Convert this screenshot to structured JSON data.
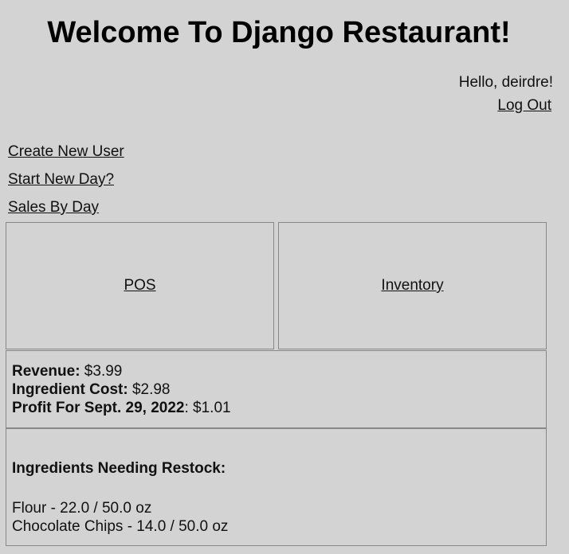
{
  "header": {
    "title": "Welcome To Django Restaurant!",
    "greeting": "Hello, deirdre!",
    "logout_label": "Log Out"
  },
  "nav": {
    "links": [
      {
        "label": "Create New User"
      },
      {
        "label": "Start New Day?"
      },
      {
        "label": "Sales By Day"
      }
    ]
  },
  "tiles": {
    "pos_label": "POS",
    "inventory_label": "Inventory"
  },
  "stats": {
    "revenue_label": "Revenue:",
    "revenue_value": " $3.99",
    "cost_label": "Ingredient Cost:",
    "cost_value": " $2.98",
    "profit_label": "Profit For Sept. 29, 2022",
    "profit_value": ": $1.01"
  },
  "restock": {
    "heading": "Ingredients Needing Restock:",
    "items": [
      "Flour - 22.0 / 50.0 oz",
      "Chocolate Chips - 14.0 / 50.0 oz"
    ]
  }
}
